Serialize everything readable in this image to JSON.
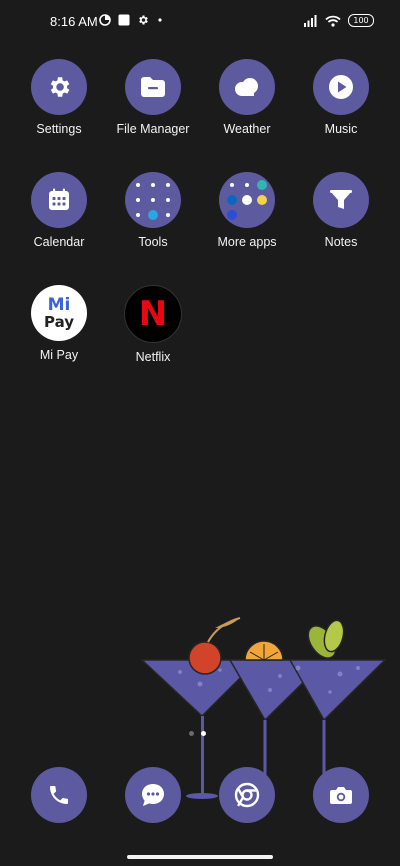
{
  "status_bar": {
    "time": "8:16 AM",
    "battery": "100",
    "left_icons": [
      "data-saver-icon",
      "notification-box-icon",
      "gear-icon",
      "dot-icon"
    ],
    "right_icons": [
      "signal-icon",
      "wifi-icon",
      "battery-icon"
    ]
  },
  "apps": [
    {
      "label": "Settings",
      "icon": "gear-icon"
    },
    {
      "label": "File Manager",
      "icon": "folder-icon"
    },
    {
      "label": "Weather",
      "icon": "cloud-icon"
    },
    {
      "label": "Music",
      "icon": "play-icon"
    },
    {
      "label": "Calendar",
      "icon": "calendar-icon"
    },
    {
      "label": "Tools",
      "icon": "folder-grid-icon"
    },
    {
      "label": "More apps",
      "icon": "folder-grid-icon"
    },
    {
      "label": "Notes",
      "icon": "notes-icon"
    },
    {
      "label": "Mi Pay",
      "icon": "mipay-logo",
      "logo_text_top": "Mi",
      "logo_text_bottom": "Pay"
    },
    {
      "label": "Netflix",
      "icon": "netflix-logo",
      "logo_text": "N"
    }
  ],
  "dock": [
    {
      "name": "phone",
      "icon": "phone-icon"
    },
    {
      "name": "messages",
      "icon": "message-icon"
    },
    {
      "name": "chrome",
      "icon": "chrome-icon"
    },
    {
      "name": "camera",
      "icon": "camera-icon"
    }
  ],
  "page_indicator": {
    "pages": 2,
    "current": 2
  },
  "colors": {
    "background": "#1b1b1b",
    "icon_bg": "#5d5aa0",
    "netflix_red": "#e50914",
    "mipay_blue": "#3a63d8"
  }
}
